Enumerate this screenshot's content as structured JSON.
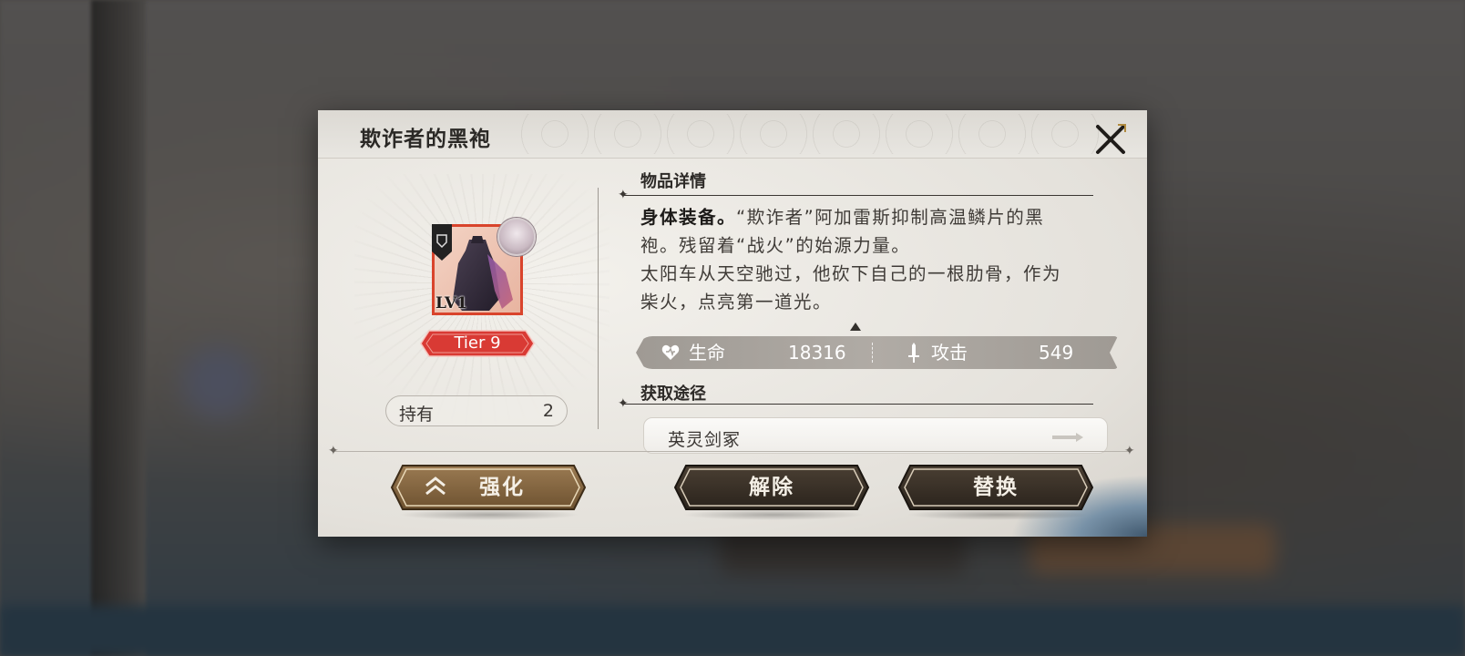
{
  "dialog": {
    "title": "欺诈者的黑袍",
    "close_icon": "close-icon"
  },
  "item": {
    "level_label": "LV1",
    "tier_label": "Tier 9",
    "hold_label": "持有",
    "hold_count": "2",
    "frame_color": "#d9442c",
    "tier_color": "#d93a34"
  },
  "details": {
    "section_title": "物品详情",
    "desc_lead": "身体装备。",
    "desc_rest": "“欺诈者”阿加雷斯抑制高温鳞片的黑袍。残留着“战火”的始源力量。",
    "desc_lore": "太阳车从天空驰过，他砍下自己的一根肋骨，作为柴火，点亮第一道光。"
  },
  "stats": {
    "hp_label": "生命",
    "hp_value": "18316",
    "atk_label": "攻击",
    "atk_value": "549"
  },
  "source": {
    "section_title": "获取途径",
    "items": [
      {
        "label": "英灵剑冢"
      }
    ]
  },
  "actions": {
    "enhance_label": "强化",
    "remove_label": "解除",
    "replace_label": "替换"
  }
}
